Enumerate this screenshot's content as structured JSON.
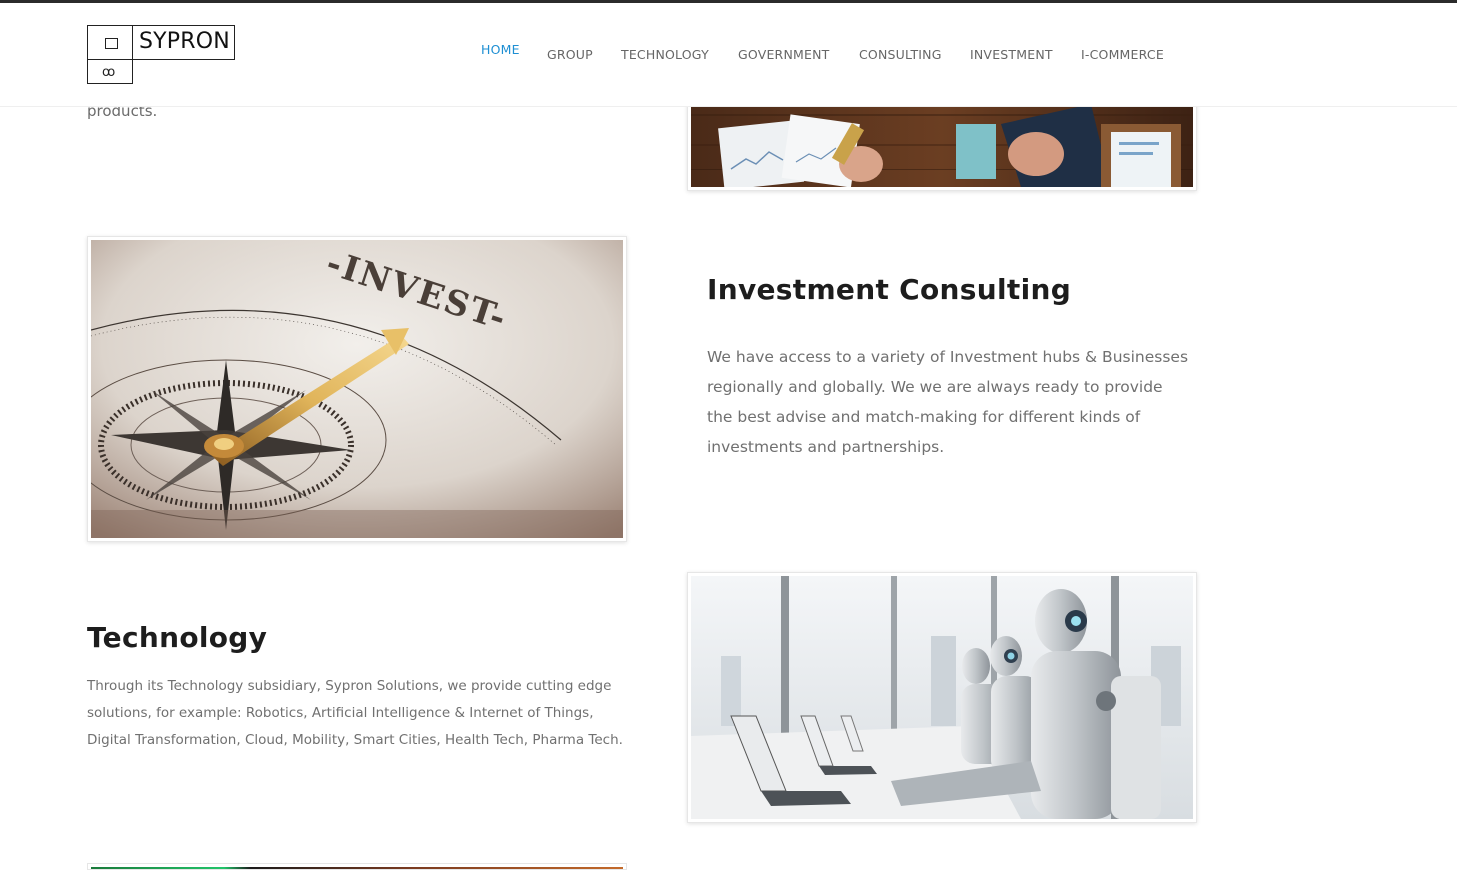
{
  "header": {
    "brand": "SYPRON",
    "logo_glyph": "ꝏ",
    "nav": [
      {
        "label": "HOME",
        "active": true
      },
      {
        "label": "GROUP"
      },
      {
        "label": "TECHNOLOGY"
      },
      {
        "label": "GOVERNMENT"
      },
      {
        "label": "CONSULTING"
      },
      {
        "label": "INVESTMENT"
      },
      {
        "label": "I-COMMERCE"
      }
    ]
  },
  "sections": {
    "previous": {
      "trailing_text": "products."
    },
    "investment": {
      "title": "Investment Consulting",
      "body": "We have access to a variety of Investment hubs & Businesses regionally and globally. We we are always ready to provide the best advise and match-making for different kinds of investments and partnerships.",
      "image_text": "-INVEST-"
    },
    "technology": {
      "title": "Technology",
      "body": "Through its Technology subsidiary, Sypron Solutions,  we provide cutting edge solutions, for example: Robotics, Artificial Intelligence & Internet of Things, Digital Transformation, Cloud, Mobility, Smart Cities, Health Tech, Pharma Tech."
    }
  },
  "colors": {
    "accent": "#1e8fd3",
    "heading": "#1d1d1d",
    "body_text": "#707070"
  }
}
